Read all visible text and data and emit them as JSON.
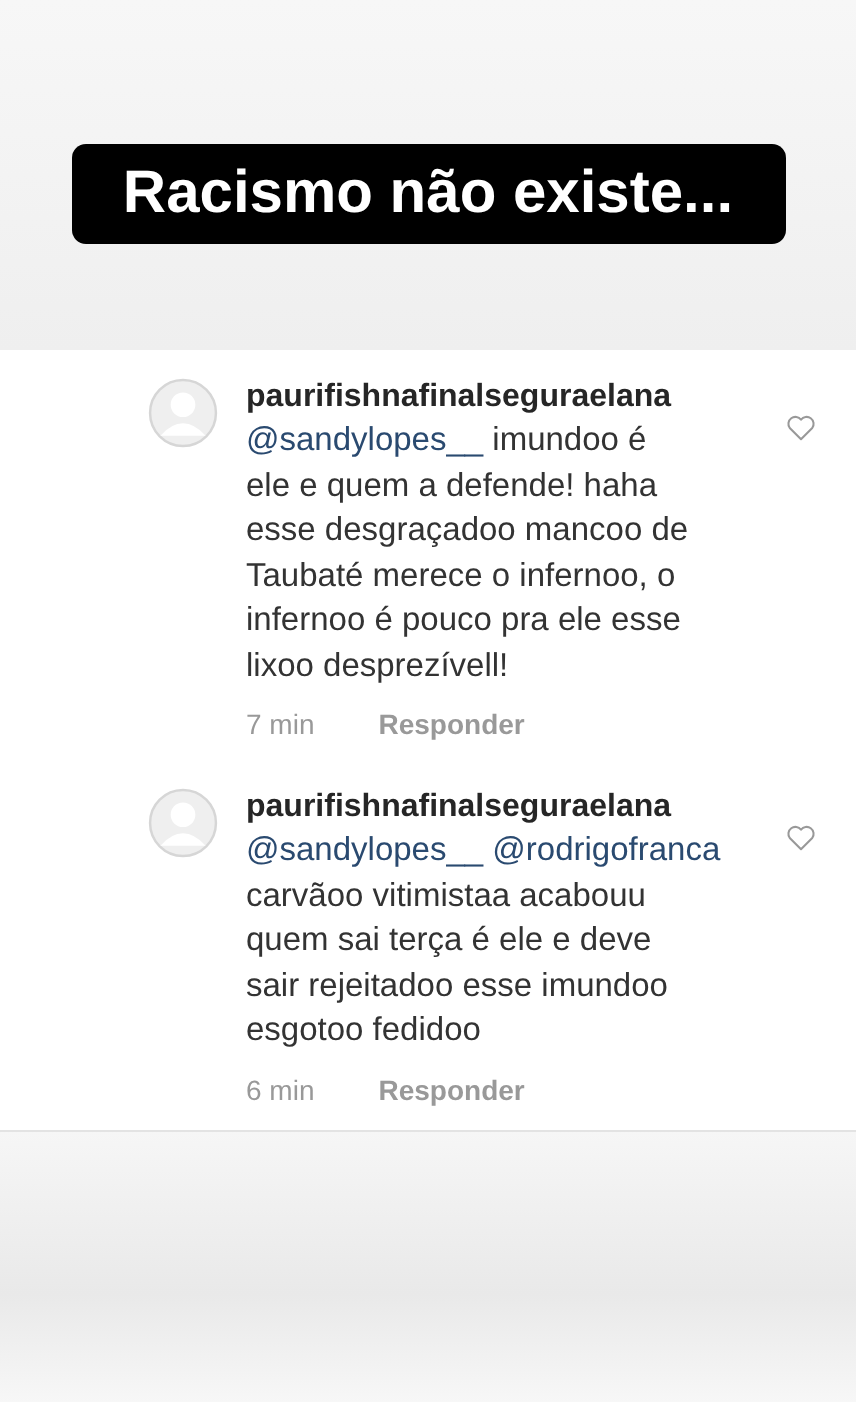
{
  "banner": {
    "title": "Racismo não existe..."
  },
  "comments": [
    {
      "username": "paurifishnafinalseguraelana",
      "mentions": [
        "@sandylopes__"
      ],
      "text": "imundoo é\nele e quem a defende! haha\nesse desgraçadoo mancoo de\nTaubaté merece o infernoo, o\ninfernoo é pouco pra ele esse\nlixoo desprezívell!",
      "time": "7 min",
      "reply": "Responder",
      "liked": false
    },
    {
      "username": "paurifishnafinalseguraelana",
      "mentions": [
        "@sandylopes__",
        "@rodrigofranca"
      ],
      "text": "\ncarvãoo vitimistaa acabouu\nquem sai terça é ele e deve\nsair rejeitadoo esse imundoo\nesgotoo fedidoo",
      "time": "6 min",
      "reply": "Responder",
      "liked": false
    }
  ]
}
